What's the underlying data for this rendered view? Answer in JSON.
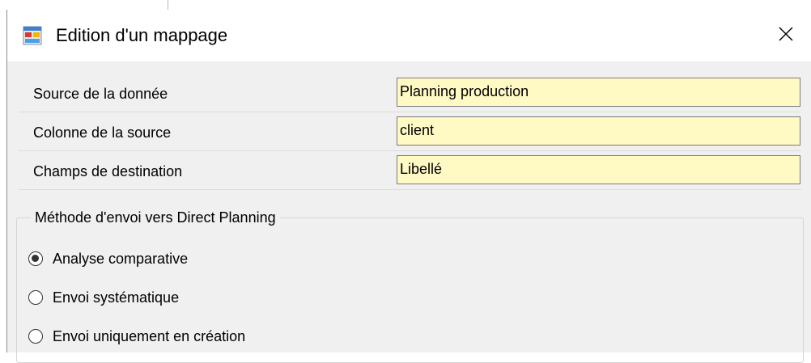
{
  "window": {
    "title": "Edition d'un mappage",
    "icon": "app-window-icon",
    "close_icon": "close-icon"
  },
  "fields": [
    {
      "label": "Source de la donnée",
      "value": "Planning production"
    },
    {
      "label": "Colonne de la source",
      "value": "client"
    },
    {
      "label": "Champs de destination",
      "value": "Libellé"
    }
  ],
  "method_group": {
    "legend": "Méthode d'envoi vers Direct Planning",
    "options": [
      {
        "label": "Analyse comparative",
        "checked": true
      },
      {
        "label": "Envoi systématique",
        "checked": false
      },
      {
        "label": "Envoi uniquement en création",
        "checked": false
      }
    ]
  },
  "colors": {
    "input_background": "#fff9c4",
    "dialog_background": "#f0f0f0",
    "titlebar_background": "#ffffff"
  }
}
